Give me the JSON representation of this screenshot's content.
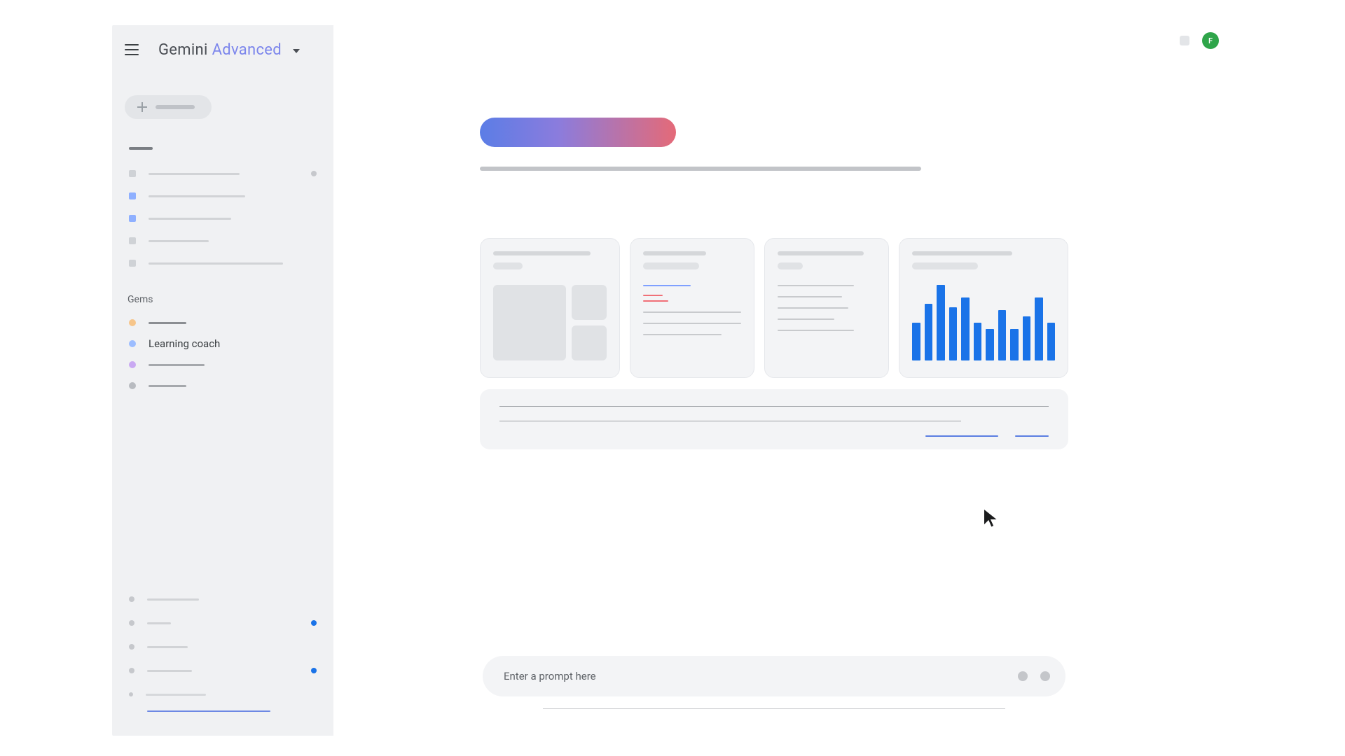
{
  "header": {
    "brand_primary": "Gemini",
    "brand_suffix": "Advanced",
    "avatar_initial": "F"
  },
  "sidebar": {
    "gems_label": "Gems",
    "gems": {
      "learning_coach": "Learning coach"
    }
  },
  "prompt": {
    "placeholder": "Enter a prompt here"
  },
  "chart_data": {
    "type": "bar",
    "values": [
      48,
      72,
      96,
      68,
      80,
      48,
      40,
      64,
      40,
      56,
      80,
      48
    ]
  },
  "colors": {
    "gem1": "#f6c58a",
    "gem2": "#9cbdff",
    "gem3": "#c9a9f2",
    "gem4": "#b8bbc0"
  }
}
